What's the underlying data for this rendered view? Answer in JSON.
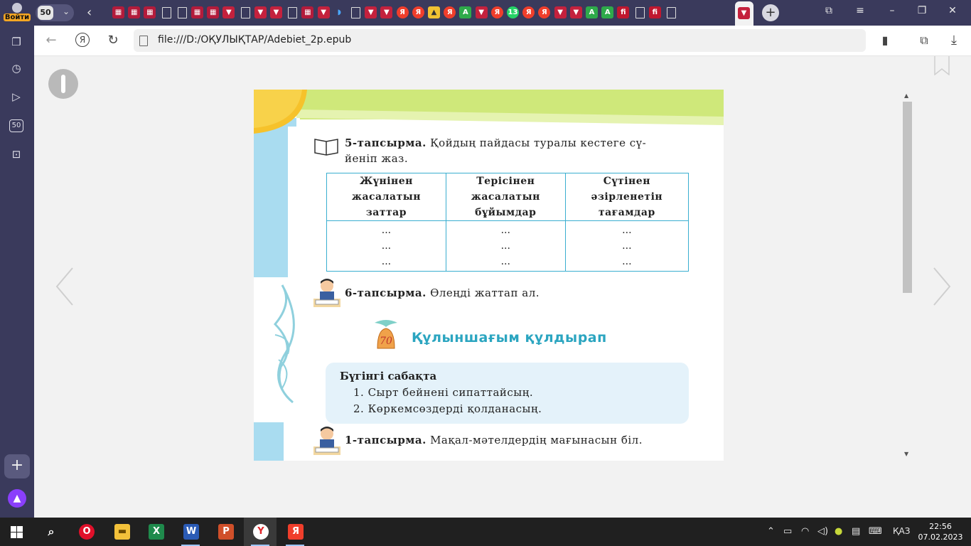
{
  "browser": {
    "profile_label": "Войти",
    "tab_count": "50",
    "url": "file:///D:/ОҚУЛЫҚТАР/Adebiet_2p.epub",
    "favicon_labels": {
      "ya": "Я",
      "fi": "fi",
      "wa": "13",
      "green": "A"
    }
  },
  "sidebar": {
    "badge": "50"
  },
  "book": {
    "task5_label": "5-тапсырма.",
    "task5_text_line1": "Қойдың пайдасы туралы кестеге сү-",
    "task5_text_line2": "йеніп жаз.",
    "table": {
      "headers": [
        [
          "Жүнінен",
          "жасалатын",
          "заттар"
        ],
        [
          "Терісінен",
          "жасалатын",
          "бұйымдар"
        ],
        [
          "Сүтінен",
          "әзірленетін",
          "тағамдар"
        ]
      ],
      "cell": [
        "...",
        "...",
        "..."
      ]
    },
    "task6_label": "6-тапсырма.",
    "task6_text": "Өлеңді жаттап ал.",
    "poem_number": "70",
    "poem_title": "Құлыншағым құлдырап",
    "today_title": "Бүгінгі сабақта",
    "today_items": [
      "1. Сырт бейнені сипаттайсың.",
      "2. Көркемсөздерді қолданасың."
    ],
    "task1_label": "1-тапсырма.",
    "task1_text": "Мақал-мәтелдердің мағынасын біл."
  },
  "taskbar": {
    "lang": "ҚАЗ",
    "time": "22:56",
    "date": "07.02.2023"
  }
}
